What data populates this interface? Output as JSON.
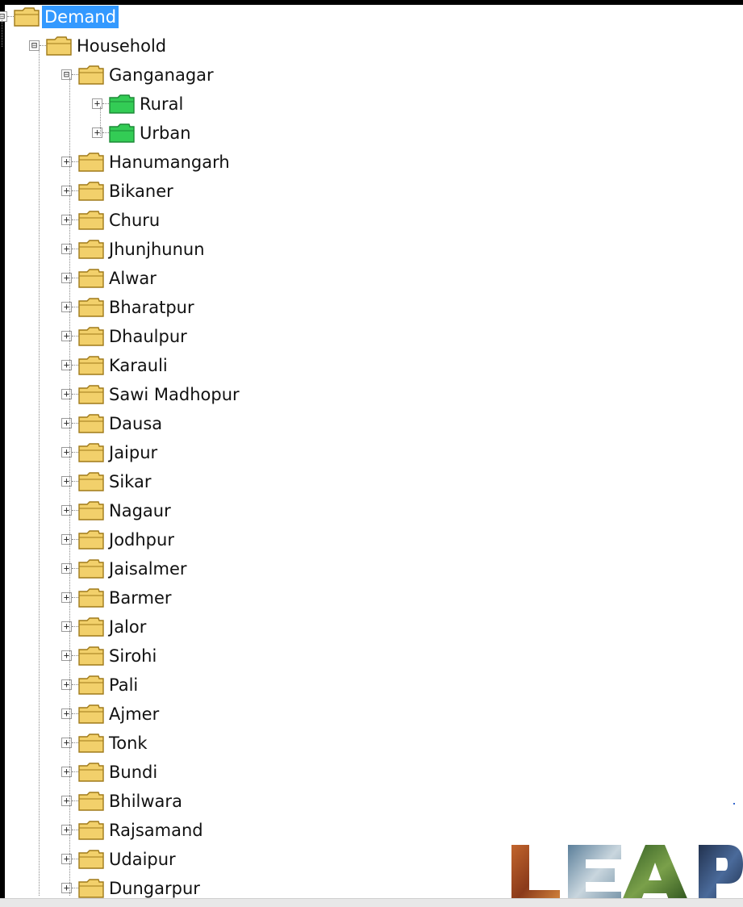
{
  "tree": {
    "root": {
      "label": "Demand",
      "expander": "⊟",
      "selected": true
    },
    "household": {
      "label": "Household",
      "expander": "⊟"
    },
    "ganganagar": {
      "label": "Ganganagar",
      "expander": "⊟",
      "children": [
        {
          "label": "Rural",
          "expander": "+"
        },
        {
          "label": "Urban",
          "expander": "+"
        }
      ]
    },
    "districts": [
      "Hanumangarh",
      "Bikaner",
      "Churu",
      "Jhunjhunun",
      "Alwar",
      "Bharatpur",
      "Dhaulpur",
      "Karauli",
      "Sawi Madhopur",
      "Dausa",
      "Jaipur",
      "Sikar",
      "Nagaur",
      "Jodhpur",
      "Jaisalmer",
      "Barmer",
      "Jalor",
      "Sirohi",
      "Pali",
      "Ajmer",
      "Tonk",
      "Bundi",
      "Bhilwara",
      "Rajsamand",
      "Udaipur",
      "Dungarpur"
    ],
    "district_expander": "+"
  },
  "icons": {
    "folder": "yellow-folder-icon",
    "leaf_folder": "green-folder-icon",
    "folder_color": "#f2d06b",
    "leaf_folder_color": "#33cc55"
  },
  "logo": {
    "text": "LEAP"
  },
  "colors": {
    "selection": "#3399ff",
    "background": "#ffffff",
    "tree_line": "#8a8a8a"
  }
}
